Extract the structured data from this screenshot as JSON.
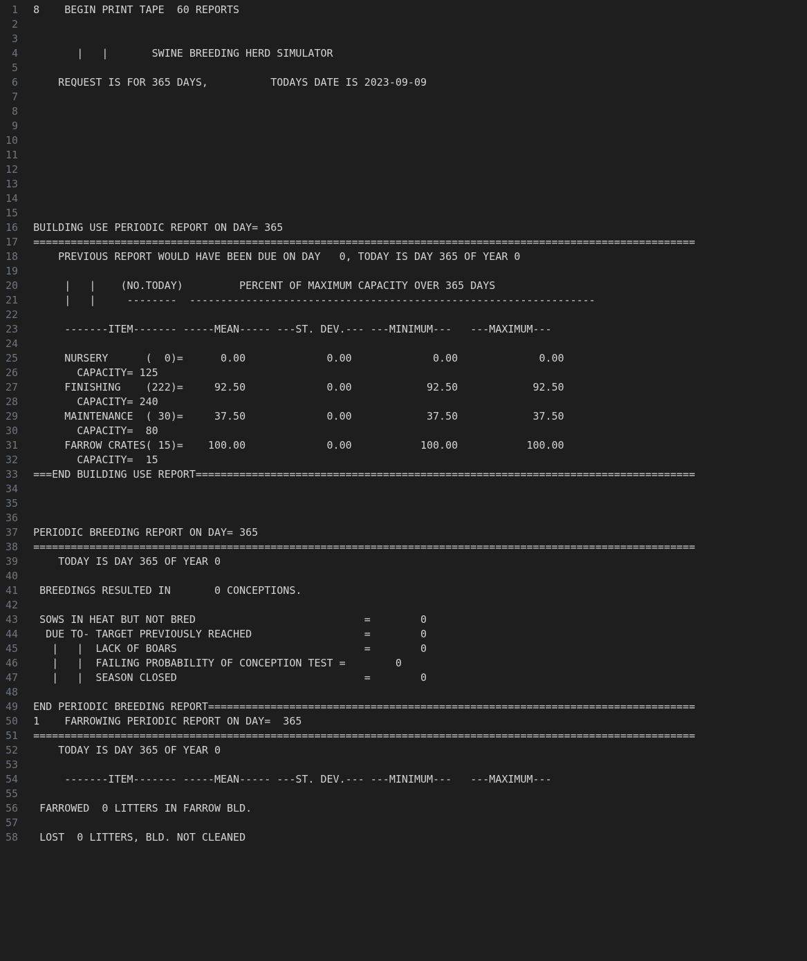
{
  "title": "SWINE BREEDING HERD SIMULATOR",
  "header": {
    "begin_line": "8    BEGIN PRINT TAPE  60 REPORTS",
    "title_line": "       |   |       SWINE BREEDING HERD SIMULATOR",
    "request_line": "    REQUEST IS FOR 365 DAYS,          TODAYS DATE IS 2023-09-09"
  },
  "building_use": {
    "title": "BUILDING USE PERIODIC REPORT ON DAY= 365",
    "day": 365,
    "sep": "==========================================================================================================",
    "prev_report": "    PREVIOUS REPORT WOULD HAVE BEEN DUE ON DAY   0, TODAY IS DAY 365 OF YEAR 0",
    "legend1": "     |   |    (NO.TODAY)         PERCENT OF MAXIMUM CAPACITY OVER 365 DAYS",
    "legend2": "     |   |     --------  -----------------------------------------------------------------",
    "columns": "     -------ITEM------- -----MEAN----- ---ST. DEV.--- ---MINIMUM---   ---MAXIMUM---",
    "rows": [
      {
        "item": "NURSERY",
        "today": 0,
        "mean": "0.00",
        "stdev": "0.00",
        "min": "0.00",
        "max": "0.00",
        "capacity": 125
      },
      {
        "item": "FINISHING",
        "today": 222,
        "mean": "92.50",
        "stdev": "0.00",
        "min": "92.50",
        "max": "92.50",
        "capacity": 240
      },
      {
        "item": "MAINTENANCE",
        "today": 30,
        "mean": "37.50",
        "stdev": "0.00",
        "min": "37.50",
        "max": "37.50",
        "capacity": 80
      },
      {
        "item": "FARROW CRATES",
        "today": 15,
        "mean": "100.00",
        "stdev": "0.00",
        "min": "100.00",
        "max": "100.00",
        "capacity": 15
      }
    ],
    "end": "===END BUILDING USE REPORT================================================================================"
  },
  "breeding": {
    "title": "PERIODIC BREEDING REPORT ON DAY= 365",
    "day": 365,
    "sep": "==========================================================================================================",
    "today_line": "    TODAY IS DAY 365 OF YEAR 0",
    "conceptions_line": " BREEDINGS RESULTED IN       0 CONCEPTIONS.",
    "conceptions": 0,
    "rows_raw": [
      " SOWS IN HEAT BUT NOT BRED                           =        0",
      "  DUE TO- TARGET PREVIOUSLY REACHED                  =        0",
      "   |   |  LACK OF BOARS                              =        0",
      "   |   |  FAILING PROBABILITY OF CONCEPTION TEST =        0",
      "   |   |  SEASON CLOSED                              =        0"
    ],
    "sows_in_heat_not_bred": 0,
    "reasons": {
      "target_previously_reached": 0,
      "lack_of_boars": 0,
      "failing_probability_of_conception_test": 0,
      "season_closed": 0
    },
    "end": "END PERIODIC BREEDING REPORT=============================================================================="
  },
  "farrowing": {
    "prefix_line": "1    FARROWING PERIODIC REPORT ON DAY=  365",
    "title": "FARROWING PERIODIC REPORT ON DAY=  365",
    "day": 365,
    "sep": "==========================================================================================================",
    "today_line": "    TODAY IS DAY 365 OF YEAR 0",
    "columns": "     -------ITEM------- -----MEAN----- ---ST. DEV.--- ---MINIMUM---   ---MAXIMUM---",
    "farrowed_line": " FARROWED  0 LITTERS IN FARROW BLD.",
    "farrowed_litters": 0,
    "lost_line": " LOST  0 LITTERS, BLD. NOT CLEANED",
    "lost_litters": 0
  },
  "lines": [
    "8    BEGIN PRINT TAPE  60 REPORTS",
    "",
    "",
    "       |   |       SWINE BREEDING HERD SIMULATOR",
    "",
    "    REQUEST IS FOR 365 DAYS,          TODAYS DATE IS 2023-09-09",
    "",
    "",
    "",
    "",
    "",
    "",
    "",
    "",
    "",
    "BUILDING USE PERIODIC REPORT ON DAY= 365",
    "==========================================================================================================",
    "    PREVIOUS REPORT WOULD HAVE BEEN DUE ON DAY   0, TODAY IS DAY 365 OF YEAR 0",
    "",
    "     |   |    (NO.TODAY)         PERCENT OF MAXIMUM CAPACITY OVER 365 DAYS",
    "     |   |     --------  -----------------------------------------------------------------",
    "",
    "     -------ITEM------- -----MEAN----- ---ST. DEV.--- ---MINIMUM---   ---MAXIMUM---",
    "",
    "     NURSERY      (  0)=      0.00             0.00             0.00             0.00",
    "       CAPACITY= 125",
    "     FINISHING    (222)=     92.50             0.00            92.50            92.50",
    "       CAPACITY= 240",
    "     MAINTENANCE  ( 30)=     37.50             0.00            37.50            37.50",
    "       CAPACITY=  80",
    "     FARROW CRATES( 15)=    100.00             0.00           100.00           100.00",
    "       CAPACITY=  15",
    "===END BUILDING USE REPORT================================================================================",
    "",
    "",
    "",
    "PERIODIC BREEDING REPORT ON DAY= 365",
    "==========================================================================================================",
    "    TODAY IS DAY 365 OF YEAR 0",
    "",
    " BREEDINGS RESULTED IN       0 CONCEPTIONS.",
    "",
    " SOWS IN HEAT BUT NOT BRED                           =        0",
    "  DUE TO- TARGET PREVIOUSLY REACHED                  =        0",
    "   |   |  LACK OF BOARS                              =        0",
    "   |   |  FAILING PROBABILITY OF CONCEPTION TEST =        0",
    "   |   |  SEASON CLOSED                              =        0",
    "",
    "END PERIODIC BREEDING REPORT==============================================================================",
    "1    FARROWING PERIODIC REPORT ON DAY=  365",
    "==========================================================================================================",
    "    TODAY IS DAY 365 OF YEAR 0",
    "",
    "     -------ITEM------- -----MEAN----- ---ST. DEV.--- ---MINIMUM---   ---MAXIMUM---",
    "",
    " FARROWED  0 LITTERS IN FARROW BLD.",
    "",
    " LOST  0 LITTERS, BLD. NOT CLEANED"
  ]
}
